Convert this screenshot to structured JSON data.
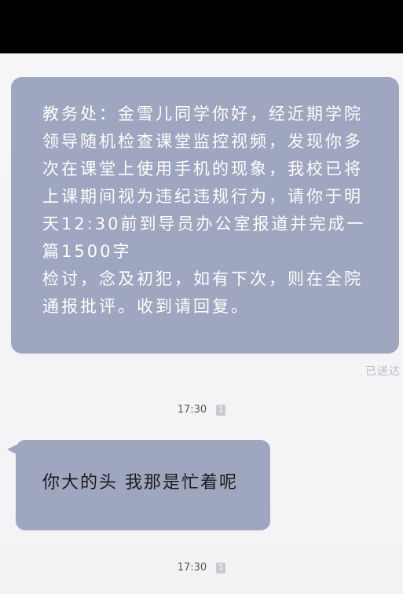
{
  "messages": [
    {
      "direction": "outgoing",
      "text": "教务处：金雪儿同学你好，经近期学院领导随机检查课堂监控视频，发现你多次在课堂上使用手机的现象，我校已将上课期间视为违纪违规行为，请你于明天12:30前到导员办公室报道并完成一篇1500字\n检讨，念及初犯，如有下次，则在全院通报批评。收到请回复。",
      "status": "已送达",
      "time": "17:30",
      "badge": "1"
    },
    {
      "direction": "incoming",
      "text": "你大的头 我那是忙着呢",
      "time": "17:30",
      "badge": "1"
    }
  ],
  "colors": {
    "bubble": "#9ea6c0",
    "background": "#f6f6f8",
    "top_bar": "#000000"
  }
}
